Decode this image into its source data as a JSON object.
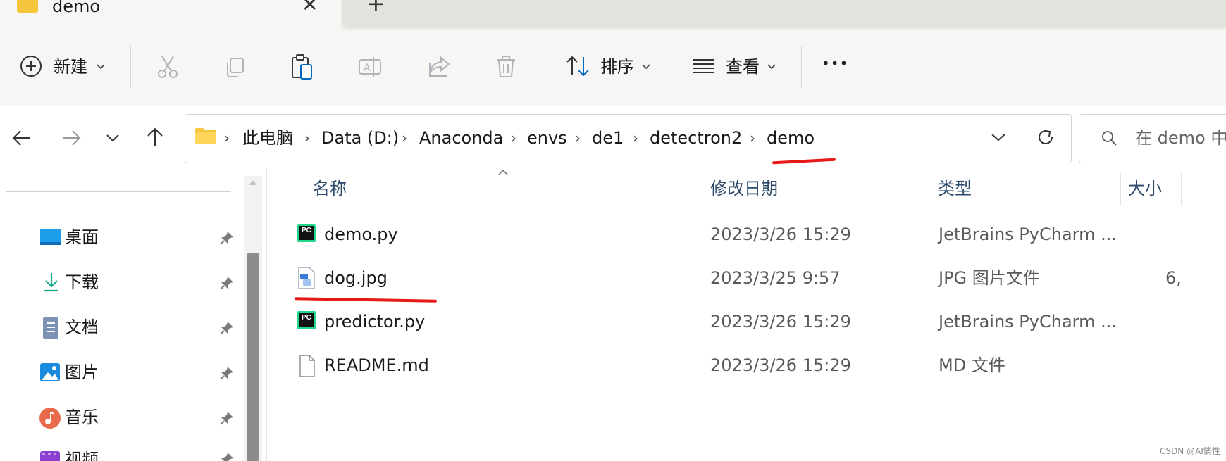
{
  "tab": {
    "title": "demo",
    "close": "✕",
    "new": "+"
  },
  "toolbar": {
    "new_label": "新建",
    "sort_label": "排序",
    "view_label": "查看",
    "more": "•••"
  },
  "address": {
    "crumbs": [
      "此电脑",
      "Data (D:)",
      "Anaconda",
      "envs",
      "de1",
      "detectron2",
      "demo"
    ],
    "search_placeholder": "在 demo 中"
  },
  "nav": {
    "items": [
      {
        "label": "桌面",
        "icon": "desktop-icon"
      },
      {
        "label": "下载",
        "icon": "download-icon"
      },
      {
        "label": "文档",
        "icon": "document-icon"
      },
      {
        "label": "图片",
        "icon": "pictures-icon"
      },
      {
        "label": "音乐",
        "icon": "music-icon"
      },
      {
        "label": "视频",
        "icon": "video-icon"
      }
    ]
  },
  "list": {
    "headers": {
      "name": "名称",
      "modified": "修改日期",
      "type": "类型",
      "size": "大小"
    },
    "files": [
      {
        "name": "demo.py",
        "modified": "2023/3/26 15:29",
        "type": "JetBrains PyCharm ...",
        "size": "",
        "icon": "pycharm-icon"
      },
      {
        "name": "dog.jpg",
        "modified": "2023/3/25 9:57",
        "type": "JPG 图片文件",
        "size": "6,",
        "icon": "jpg-file-icon"
      },
      {
        "name": "predictor.py",
        "modified": "2023/3/26 15:29",
        "type": "JetBrains PyCharm ...",
        "size": "",
        "icon": "pycharm-icon"
      },
      {
        "name": "README.md",
        "modified": "2023/3/26 15:29",
        "type": "MD 文件",
        "size": "",
        "icon": "blank-file-icon"
      }
    ]
  },
  "watermark": "CSDN @AI情性",
  "colors": {
    "annotation_red": "#e81818",
    "accent_blue": "#0067c0"
  }
}
